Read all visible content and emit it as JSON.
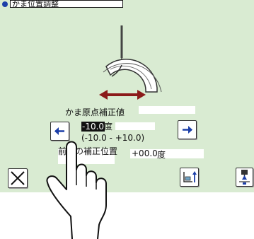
{
  "window": {
    "title": "かま位置調整"
  },
  "origin_correction": {
    "label": "かま原点補正値",
    "value": "-10.0",
    "unit": "度",
    "range": "(-10.0 - +10.0)"
  },
  "previous_correction": {
    "label": "前回の補正位置",
    "value": "+00.0",
    "unit": "度"
  },
  "icons": {
    "decrease": "left-arrow-icon",
    "increase": "right-arrow-icon",
    "cancel": "close-x-icon",
    "tool_1": "presser-up-icon",
    "tool_2": "needle-position-icon"
  },
  "colors": {
    "panel_bg": "#d9ebd2",
    "accent_blue": "#1c3fa8",
    "arrow_red": "#8b1a1a",
    "value_highlight": "#111111"
  }
}
